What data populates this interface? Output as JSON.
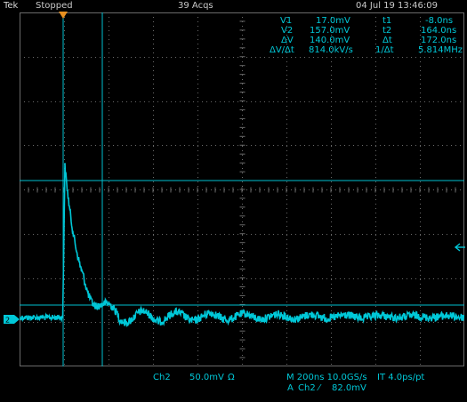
{
  "header": {
    "brand": "Tek",
    "state": "Stopped",
    "acquisitions": "39 Acqs",
    "datetime": "04 Jul 19 13:46:09"
  },
  "measurements": {
    "v1_label": "V1",
    "v1_value": "17.0mV",
    "v2_label": "V2",
    "v2_value": "157.0mV",
    "dv_label": "ΔV",
    "dv_value": "140.0mV",
    "rate_label": "ΔV/Δt",
    "rate_value": "814.0kV/s",
    "t1_label": "t1",
    "t1_value": "-8.0ns",
    "t2_label": "t2",
    "t2_value": "164.0ns",
    "dt_label": "Δt",
    "dt_value": "172.0ns",
    "freq_label": "1/Δt",
    "freq_value": "5.814MHz"
  },
  "footer": {
    "channel": "Ch2",
    "volts_per_div": "50.0mV",
    "coupling_symbol": "Ω",
    "timebase": "M 200ns 10.0GS/s",
    "interpolation": "IT 4.0ps/pt",
    "trigger_source_prefix": "A",
    "trigger_source": "Ch2",
    "trigger_slope": "⁄",
    "trigger_level": "82.0mV"
  },
  "markers": {
    "trigger_position_icon": "orange-down-triangle",
    "channel_ground_icon": "ch2-ground-marker",
    "trigger_level_icon": "left-arrow"
  },
  "colors": {
    "trace": "#00c8d8",
    "cursor": "#00c0d0",
    "grid": "#808080",
    "trigger_marker": "#e89020"
  }
}
